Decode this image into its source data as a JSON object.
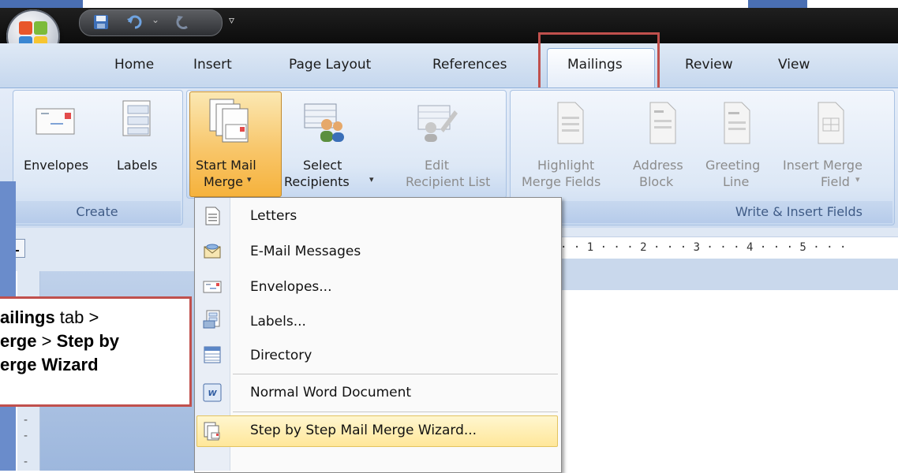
{
  "tabs": [
    "Home",
    "Insert",
    "Page Layout",
    "References",
    "Mailings",
    "Review",
    "View"
  ],
  "active_tab": "Mailings",
  "ribbon": {
    "create_group": {
      "label": "Create",
      "envelopes": "Envelopes",
      "labels": "Labels"
    },
    "start_group": {
      "start_mail_line1": "Start Mail",
      "start_mail_line2": "Merge",
      "select_line1": "Select",
      "select_line2": "Recipients",
      "edit_line1": "Edit",
      "edit_line2": "Recipient List"
    },
    "write_group": {
      "label": "Write & Insert Fields",
      "highlight_line1": "Highlight",
      "highlight_line2": "Merge Fields",
      "address_line1": "Address",
      "address_line2": "Block",
      "greeting_line1": "Greeting",
      "greeting_line2": "Line",
      "insert_line1": "Insert Merge",
      "insert_line2": "Field"
    }
  },
  "ruler_text": "· · 1 · · · 2 · · · 3 · · · 4 · · · 5 · · ·",
  "ruler_corner": "L",
  "menu_items": [
    "Letters",
    "E-Mail Messages",
    "Envelopes...",
    "Labels...",
    "Directory",
    "Normal Word Document",
    "Step by Step Mail Merge Wizard..."
  ],
  "callout": {
    "line1_bold": "ailings",
    "line1_rest": " tab >",
    "line2_bold": "erge",
    "line2_mid": " > ",
    "line2_bold2": "Step by",
    "line3_bold": "erge Wizard"
  },
  "colors": {
    "highlight_border": "#c0504d",
    "ribbon_bg": "#dde8f6",
    "hover": "#ffe79a"
  }
}
